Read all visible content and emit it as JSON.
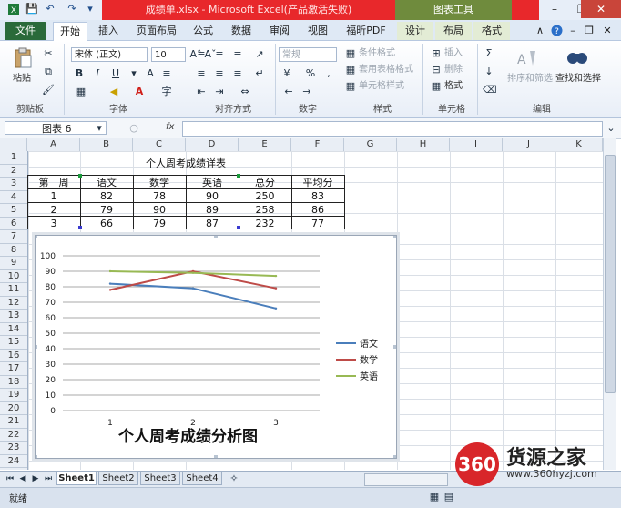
{
  "window": {
    "title": "成绩单.xlsx - Microsoft Excel(产品激活失败)",
    "context_group": "图表工具"
  },
  "tabs": [
    "文件",
    "开始",
    "插入",
    "页面布局",
    "公式",
    "数据",
    "审阅",
    "视图",
    "福昕PDF",
    "设计",
    "布局",
    "格式"
  ],
  "ribbon": {
    "paste": "粘贴",
    "font_name": "宋体 (正文)",
    "font_size": "10",
    "number_format": "常规",
    "conditional_format": "条件格式",
    "table_format": "套用表格格式",
    "cell_style": "单元格样式",
    "insert": "插入",
    "delete": "删除",
    "format": "格式",
    "sort_filter": "排序和筛选",
    "find_select": "查找和选择",
    "groups": [
      "剪贴板",
      "字体",
      "对齐方式",
      "数字",
      "样式",
      "单元格",
      "编辑"
    ]
  },
  "formula_bar": {
    "name_box": "图表 6",
    "fx": "fx"
  },
  "columns": [
    "A",
    "B",
    "C",
    "D",
    "E",
    "F",
    "G",
    "H",
    "I",
    "J",
    "K"
  ],
  "rows": [
    "1",
    "2",
    "3",
    "4",
    "5",
    "6",
    "7",
    "8",
    "9",
    "10",
    "11",
    "12",
    "13",
    "14",
    "15",
    "16",
    "17",
    "18",
    "19",
    "20",
    "21",
    "22",
    "23",
    "24"
  ],
  "sheet": {
    "table_title": "个人周考成绩详表",
    "headers": [
      "第　周",
      "语文",
      "数学",
      "英语",
      "总分",
      "平均分"
    ],
    "data": [
      [
        "1",
        "82",
        "78",
        "90",
        "250",
        "83"
      ],
      [
        "2",
        "79",
        "90",
        "89",
        "258",
        "86"
      ],
      [
        "3",
        "66",
        "79",
        "87",
        "232",
        "77"
      ]
    ]
  },
  "chart_data": {
    "type": "line",
    "title": "个人周考成绩分析图",
    "categories": [
      "1",
      "2",
      "3"
    ],
    "series": [
      {
        "name": "语文",
        "values": [
          82,
          79,
          66
        ],
        "color": "#4a7ebb"
      },
      {
        "name": "数学",
        "values": [
          78,
          90,
          79
        ],
        "color": "#be4b48"
      },
      {
        "name": "英语",
        "values": [
          90,
          89,
          87
        ],
        "color": "#98b954"
      }
    ],
    "ylim": [
      0,
      100
    ],
    "yticks": [
      "0",
      "10",
      "20",
      "30",
      "40",
      "50",
      "60",
      "70",
      "80",
      "90",
      "100"
    ],
    "grid": true,
    "legend": "right"
  },
  "sheet_tabs": [
    "Sheet1",
    "Sheet2",
    "Sheet3",
    "Sheet4"
  ],
  "status": {
    "text": "就绪"
  },
  "watermark": {
    "logo": "360",
    "name": "货源之家",
    "url": "www.360hyzj.com"
  }
}
